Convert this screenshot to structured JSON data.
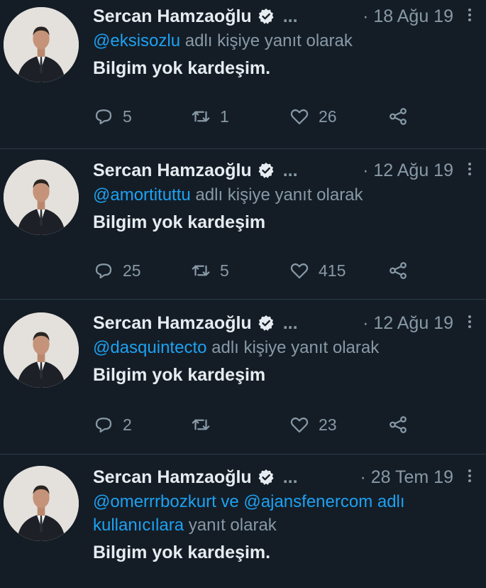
{
  "tweets": [
    {
      "author": "Sercan Hamzaoğlu",
      "ellipsis": "...",
      "date": "· 18 Ağu 19",
      "reply_mentions": "@eksisozlu",
      "reply_mentions_2": "",
      "reply_suffix": " adlı kişiye yanıt olarak",
      "reply_suffix_line2": "",
      "text": "Bilgim yok kardeşim.",
      "replies": "5",
      "retweets": "1",
      "likes": "26"
    },
    {
      "author": "Sercan Hamzaoğlu",
      "ellipsis": "...",
      "date": "· 12 Ağu 19",
      "reply_mentions": "@amortituttu",
      "reply_mentions_2": "",
      "reply_suffix": " adlı kişiye yanıt olarak",
      "reply_suffix_line2": "",
      "text": "Bilgim yok kardeşim",
      "replies": "25",
      "retweets": "5",
      "likes": "415"
    },
    {
      "author": "Sercan Hamzaoğlu",
      "ellipsis": "...",
      "date": "· 12 Ağu 19",
      "reply_mentions": "@dasquintecto",
      "reply_mentions_2": "",
      "reply_suffix": " adlı kişiye yanıt olarak",
      "reply_suffix_line2": "",
      "text": "Bilgim yok kardeşim",
      "replies": "2",
      "retweets": "",
      "likes": "23"
    },
    {
      "author": "Sercan Hamzaoğlu",
      "ellipsis": "...",
      "date": "· 28 Tem 19",
      "reply_mentions": "@omerrrbozkurt ve @ajansfenercom adlı",
      "reply_mentions_2": "kullanıcılara",
      "reply_suffix": "",
      "reply_suffix_line2": " yanıt olarak",
      "text": "Bilgim yok kardeşim.",
      "replies": "",
      "retweets": "",
      "likes": ""
    }
  ],
  "icons": {
    "verified": "verified-badge-icon",
    "reply": "reply-icon",
    "retweet": "retweet-icon",
    "like": "heart-icon",
    "share": "share-icon",
    "more": "more-vertical-icon"
  },
  "colors": {
    "background": "#141d26",
    "text": "#e6ecf0",
    "muted": "#8899a6",
    "link": "#1da1f2",
    "divider": "#2b3a48"
  }
}
